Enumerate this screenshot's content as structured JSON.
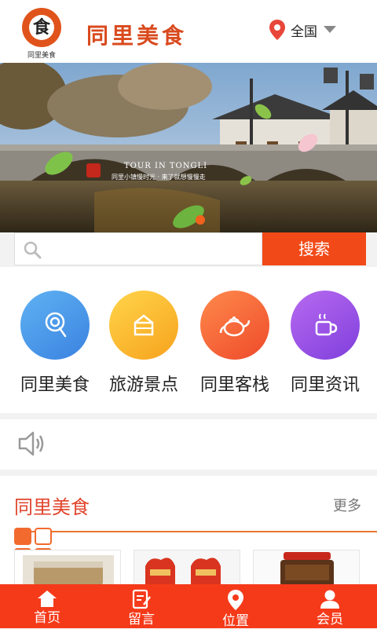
{
  "header": {
    "logo_glyph": "食",
    "logo_caption": "同里美食",
    "brand": "同里美食",
    "location": "全国"
  },
  "banner": {
    "title": "TOUR IN TONGLI",
    "subtitle": "同里小镇慢时光 · 来了就想慢慢走"
  },
  "search": {
    "placeholder": "",
    "button": "搜索"
  },
  "categories": [
    {
      "label": "同里美食",
      "icon": "lollipop-icon"
    },
    {
      "label": "旅游景点",
      "icon": "cake-icon"
    },
    {
      "label": "同里客栈",
      "icon": "teapot-icon"
    },
    {
      "label": "同里资讯",
      "icon": "coffee-cup-icon"
    }
  ],
  "section": {
    "title": "同里美食",
    "more": "更多"
  },
  "tabs": [
    {
      "label": "首页",
      "icon": "home-icon"
    },
    {
      "label": "留言",
      "icon": "message-icon"
    },
    {
      "label": "位置",
      "icon": "location-icon"
    },
    {
      "label": "会员",
      "icon": "user-icon"
    }
  ],
  "colors": {
    "accent": "#f14a18",
    "tabbar": "#f53a1a",
    "section_title": "#e0442b"
  }
}
